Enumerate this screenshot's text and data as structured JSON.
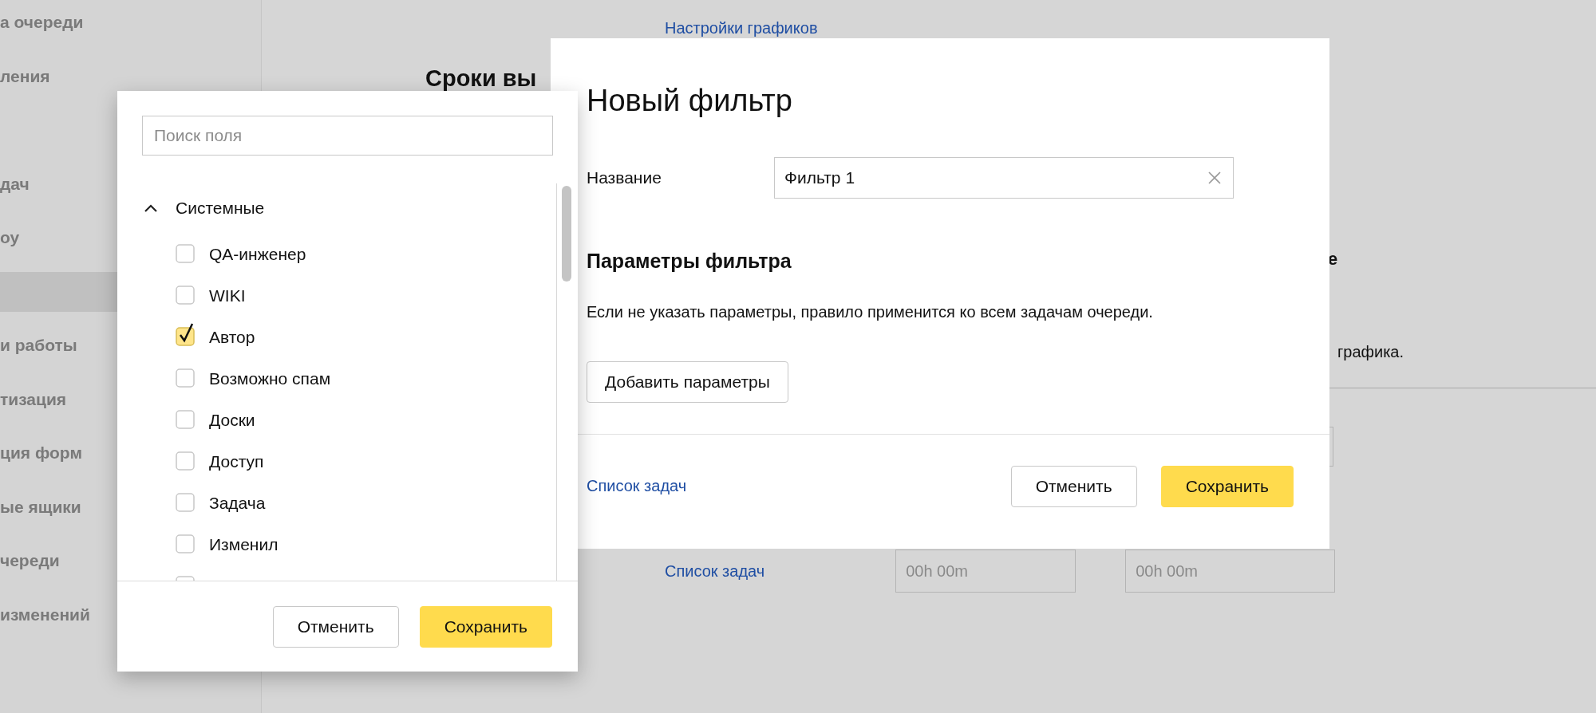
{
  "sidebar": {
    "items": [
      {
        "label": "а очереди",
        "selected": false
      },
      {
        "label": "ления",
        "selected": false
      },
      {
        "label": "дач",
        "selected": false
      },
      {
        "label": "оу",
        "selected": false
      },
      {
        "selected": true
      },
      {
        "label": "и работы",
        "selected": false
      },
      {
        "label": "тизация",
        "selected": false
      },
      {
        "label": "ция форм",
        "selected": false
      },
      {
        "label": "ые ящики",
        "selected": false
      },
      {
        "label": "череди",
        "selected": false
      },
      {
        "label": "изменений",
        "selected": false
      }
    ]
  },
  "page": {
    "settings_link": "Настройки графиков",
    "heading": "Сроки вы",
    "heading_tail": "е",
    "note_tail": "графика.",
    "task_list_link": "Список задач",
    "time_fields": [
      {
        "placeholder": "00h 00m"
      },
      {
        "placeholder": "00h 00m"
      }
    ]
  },
  "field_picker": {
    "search": {
      "placeholder": "Поиск поля"
    },
    "group": {
      "label": "Системные",
      "expanded": true
    },
    "fields": [
      {
        "label": "QA-инженер",
        "checked": false
      },
      {
        "label": "WIKI",
        "checked": false
      },
      {
        "label": "Автор",
        "checked": true
      },
      {
        "label": "Возможно спам",
        "checked": false
      },
      {
        "label": "Доски",
        "checked": false
      },
      {
        "label": "Доступ",
        "checked": false
      },
      {
        "label": "Задача",
        "checked": false
      },
      {
        "label": "Изменил",
        "checked": false
      },
      {
        "checked": false
      }
    ],
    "buttons": {
      "cancel": "Отменить",
      "save": "Сохранить"
    }
  },
  "dialog": {
    "title": "Новый фильтр",
    "name_label": "Название",
    "name_value": "Фильтр 1",
    "params_heading": "Параметры фильтра",
    "params_hint": "Если не указать параметры, правило применится ко всем задачам очереди.",
    "add_button": "Добавить параметры",
    "footer_link": "Список задач",
    "buttons": {
      "cancel": "Отменить",
      "save": "Сохранить"
    }
  }
}
